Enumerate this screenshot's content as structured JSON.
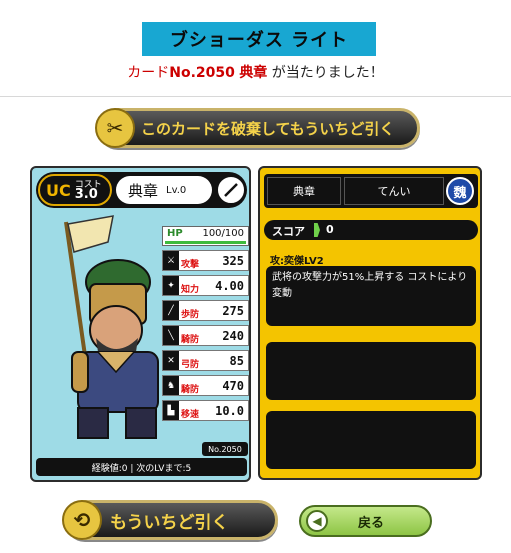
{
  "header": {
    "title": "ブショーダス ライト",
    "result_prefix": "カード",
    "card_no": "No.2050",
    "card_name": "典章",
    "result_suffix": " が当たりました！"
  },
  "buttons": {
    "discard": "このカードを破棄してもういちど引く",
    "again": "もういちど引く",
    "back": "戻る"
  },
  "card": {
    "rarity": "UC",
    "cost_label": "コスト",
    "cost": "3.0",
    "name": "典章",
    "level": "Lv.0",
    "hp_label": "HP",
    "hp": "100/100",
    "hp_fraction": 1.0,
    "stats": [
      {
        "label": "攻撃",
        "value": "325",
        "icon": "sword-icon"
      },
      {
        "label": "知力",
        "value": "4.00",
        "icon": "spark-icon"
      },
      {
        "label": "歩防",
        "value": "275",
        "icon": "spear-icon"
      },
      {
        "label": "騎防",
        "value": "240",
        "icon": "lance-icon"
      },
      {
        "label": "弓防",
        "value": "85",
        "icon": "bow-icon"
      },
      {
        "label": "騎防",
        "value": "470",
        "icon": "horse-icon"
      },
      {
        "label": "移速",
        "value": "10.0",
        "icon": "boot-icon"
      }
    ],
    "number_tag": "No.2050",
    "exp_text": "経験値:0 | 次のLVまで:5"
  },
  "info": {
    "name": "典章",
    "reading": "てんい",
    "kingdom": "魏",
    "kingdom_color": "#1e4aa8",
    "score_label": "スコア",
    "score": "0",
    "skill_name": "攻:奕傑LV2",
    "skill_desc": "武将の攻撃力が51%上昇する コストにより変動"
  }
}
